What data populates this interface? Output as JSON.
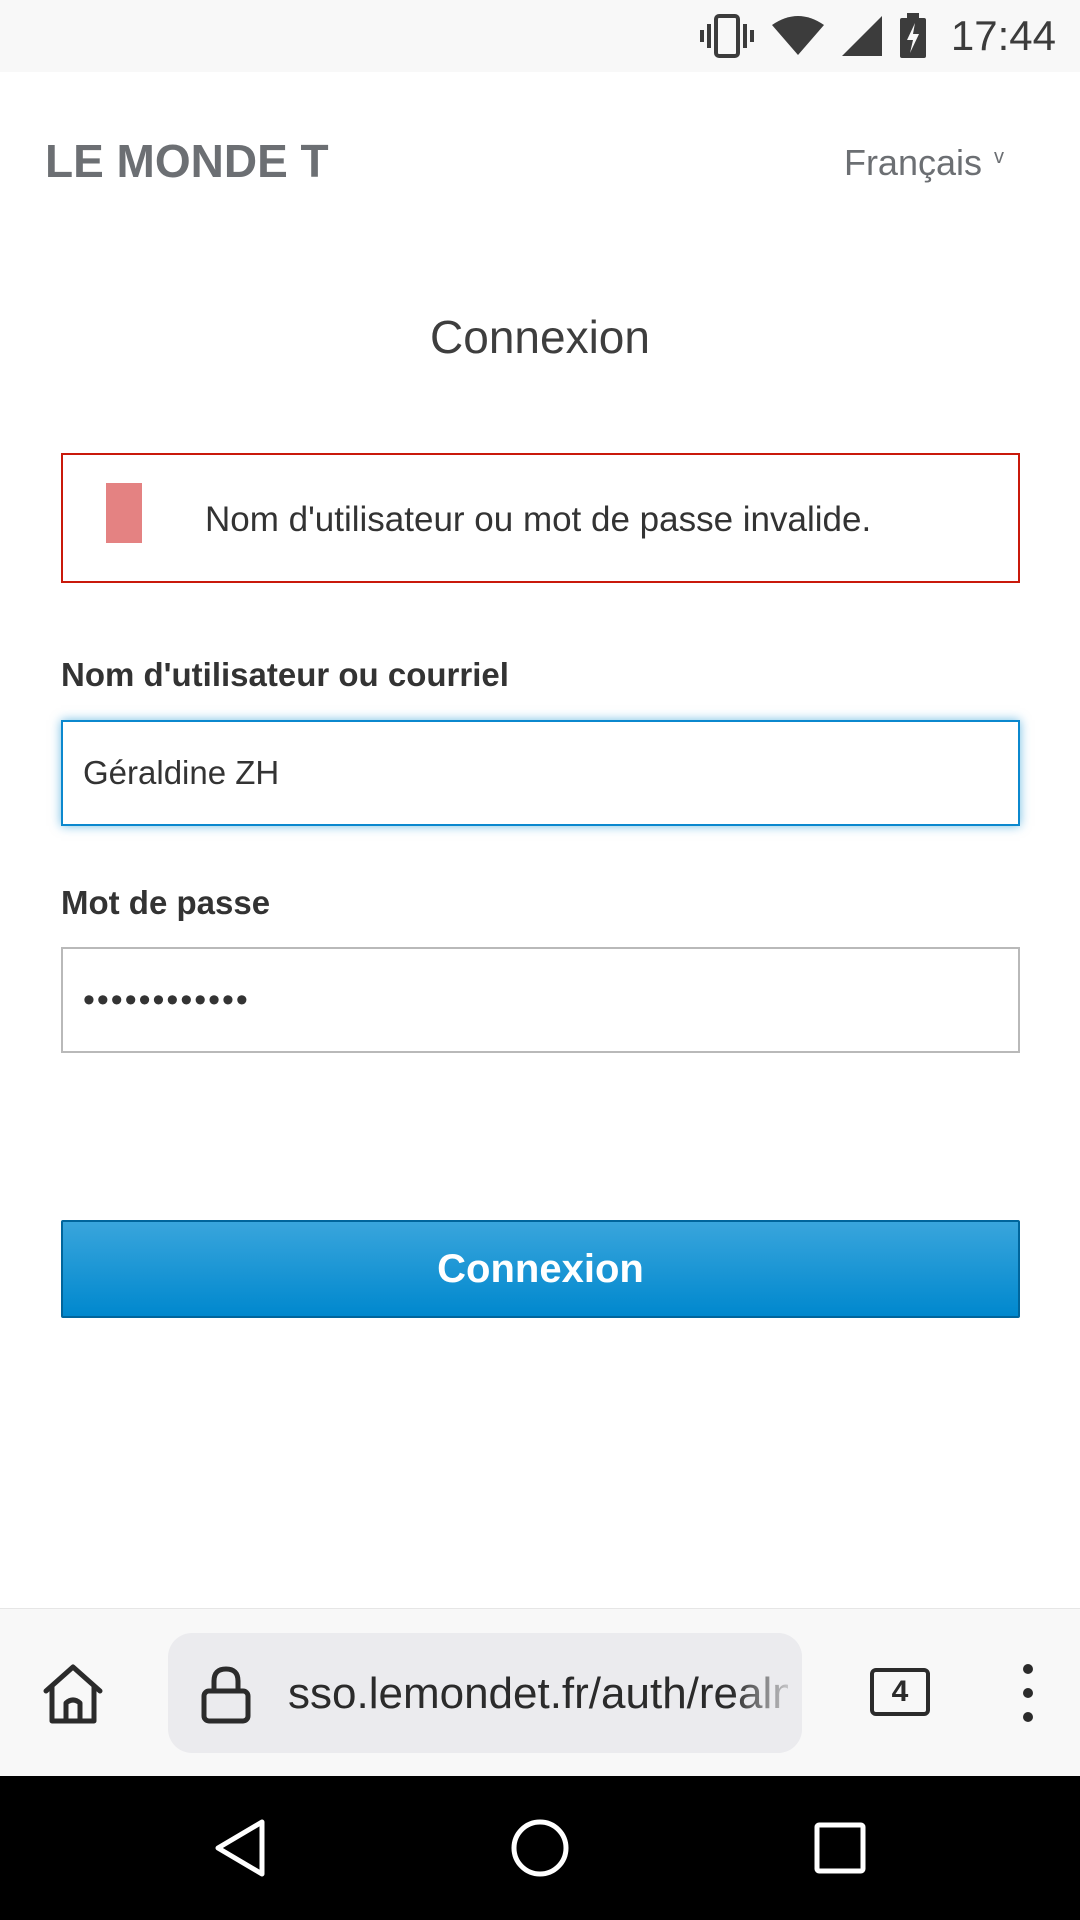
{
  "status_bar": {
    "time": "17:44",
    "icons": [
      "vibrate-icon",
      "wifi-icon",
      "signal-icon",
      "battery-charging-icon"
    ]
  },
  "header": {
    "brand": "LE MONDE T",
    "language": "Français",
    "language_chevron": "v"
  },
  "page": {
    "title": "Connexion"
  },
  "alert": {
    "message": "Nom d'utilisateur ou mot de passe invalide.",
    "color": "#c9190b"
  },
  "form": {
    "username_label": "Nom d'utilisateur ou courriel",
    "username_value": "Géraldine ZH",
    "password_label": "Mot de passe",
    "password_value": "••••••••••••",
    "submit_label": "Connexion",
    "accent_color": "#0088ce"
  },
  "browser": {
    "url": "sso.lemondet.fr/auth/realms",
    "tab_count": "4",
    "icons": [
      "home-icon",
      "lock-icon",
      "tabs-icon",
      "more-vert-icon"
    ]
  },
  "nav_bar": {
    "icons": [
      "back-icon",
      "home-circle-icon",
      "recent-apps-icon"
    ]
  }
}
